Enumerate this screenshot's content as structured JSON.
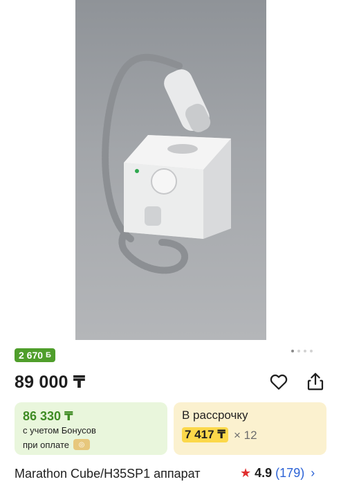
{
  "bonus_badge": {
    "value": "2 670",
    "icon": "Б"
  },
  "price": {
    "main": "89 000 ₸"
  },
  "actions": {
    "favorite_icon": "heart-icon",
    "share_icon": "share-icon"
  },
  "gallery": {
    "dot_count": 4,
    "active_index": 0
  },
  "bonus_card": {
    "price": "86 330 ₸",
    "line1": "с учетом Бонусов",
    "line2": "при оплате"
  },
  "installment_card": {
    "label": "В рассрочку",
    "amount": "7 417 ₸",
    "multiplier": "× 12"
  },
  "product": {
    "title": "Marathon Cube/H35SP1 аппарат",
    "rating": "4.9",
    "reviews": "(179)"
  },
  "colors": {
    "green": "#4f9e2b",
    "yellow": "#fcd84a",
    "blue": "#2b62d6",
    "star": "#e02e2e"
  }
}
